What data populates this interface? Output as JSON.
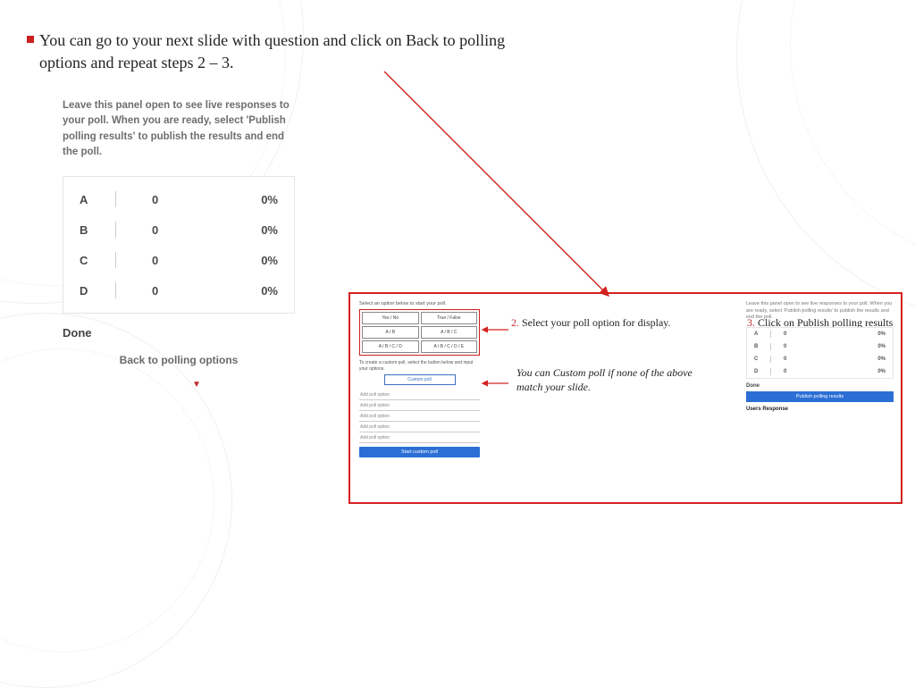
{
  "bullet": "You can go to your next slide with question and click on Back to polling options and repeat steps 2 – 3.",
  "leftPanel": {
    "desc": "Leave this panel open to see live responses to your poll. When you are ready, select 'Publish polling results' to publish the results and end the poll.",
    "rows": [
      {
        "opt": "A",
        "cnt": "0",
        "pct": "0%"
      },
      {
        "opt": "B",
        "cnt": "0",
        "pct": "0%"
      },
      {
        "opt": "C",
        "cnt": "0",
        "pct": "0%"
      },
      {
        "opt": "D",
        "cnt": "0",
        "pct": "0%"
      }
    ],
    "done": "Done",
    "back": "Back to polling options"
  },
  "pollOptions": {
    "hdr": "Select an option below to start your poll.",
    "btns": [
      "Yes / No",
      "True / False",
      "A / B",
      "A / B / C",
      "A / B / C / D",
      "A / B / C / D / E"
    ],
    "sub": "To create a custom poll, select the button below and input your options.",
    "custom": "Custom poll",
    "add": "Add poll option",
    "start": "Start custom poll"
  },
  "mini2": {
    "desc": "Leave this panel open to see live responses to your poll. When you are ready, select 'Publish polling results' to publish the results and end the poll.",
    "rows": [
      {
        "o": "A",
        "c": "0",
        "p": "0%"
      },
      {
        "o": "B",
        "c": "0",
        "p": "0%"
      },
      {
        "o": "C",
        "c": "0",
        "p": "0%"
      },
      {
        "o": "D",
        "c": "0",
        "p": "0%"
      }
    ],
    "done": "Done",
    "publish": "Publish polling results",
    "ur": "Users Response"
  },
  "instr": {
    "n2": "2.",
    "t2": " Select your poll option for display.",
    "t2b": "You can Custom poll if none of the above match your slide.",
    "n3": "3.",
    "t3": " Click on Publish polling results when ready to display to students"
  }
}
